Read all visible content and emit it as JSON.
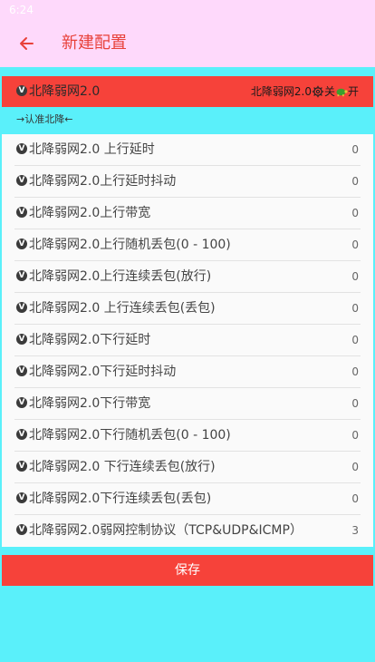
{
  "status_bar": {
    "time": "6:24"
  },
  "appbar": {
    "title": "新建配置"
  },
  "header": {
    "badge": "V",
    "title": "北降弱网2.0",
    "right_label": "北降弱网2.0",
    "off_label": "关",
    "on_label": "开"
  },
  "subtitle": "→认准北降←",
  "items": [
    {
      "label": "北降弱网2.0 上行延时",
      "value": "0"
    },
    {
      "label": "北降弱网2.0上行延时抖动",
      "value": "0"
    },
    {
      "label": "北降弱网2.0上行带宽",
      "value": "0"
    },
    {
      "label": "北降弱网2.0上行随机丢包(0 - 100)",
      "value": "0"
    },
    {
      "label": "北降弱网2.0上行连续丢包(放行)",
      "value": "0"
    },
    {
      "label": "北降弱网2.0 上行连续丢包(丢包)",
      "value": "0"
    },
    {
      "label": "北降弱网2.0下行延时",
      "value": "0"
    },
    {
      "label": "北降弱网2.0下行延时抖动",
      "value": "0"
    },
    {
      "label": "北降弱网2.0下行带宽",
      "value": "0"
    },
    {
      "label": "北降弱网2.0下行随机丢包(0 - 100)",
      "value": "0"
    },
    {
      "label": "北降弱网2.0 下行连续丢包(放行)",
      "value": "0"
    },
    {
      "label": "北降弱网2.0下行连续丢包(丢包)",
      "value": "0"
    },
    {
      "label": "北降弱网2.0弱网控制协议（TCP&UDP&ICMP）",
      "value": "3"
    }
  ],
  "save_label": "保存",
  "colors": {
    "appbar_bg": "#fed9fb",
    "accent_red": "#f6423a",
    "page_bg": "#5af0fa",
    "list_bg": "#fafafa"
  },
  "icons": {
    "back": "arrow-left-icon",
    "settings": "gear-icon",
    "turtle": "turtle-icon"
  }
}
